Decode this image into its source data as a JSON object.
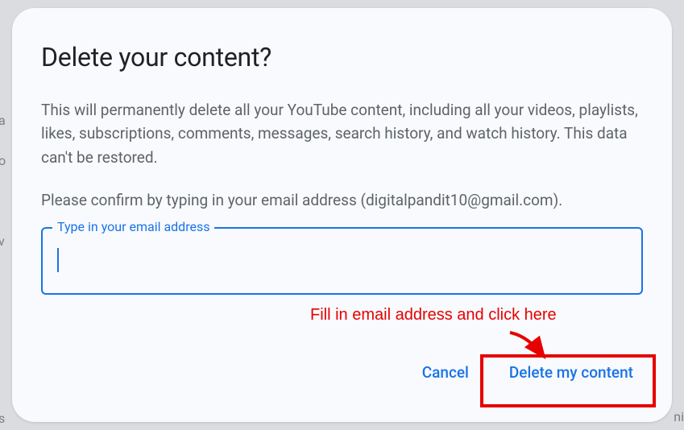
{
  "dialog": {
    "title": "Delete your content?",
    "body": "This will permanently delete all your YouTube content, including all your videos, playlists, likes, subscriptions, comments, messages, search history, and watch history. This data can't be restored.",
    "confirm_prompt": "Please confirm by typing in your email address (digitalpandit10@gmail.com).",
    "input_label": "Type in your email address",
    "input_value": "",
    "buttons": {
      "cancel": "Cancel",
      "delete": "Delete my content"
    }
  },
  "annotation": {
    "text": "Fill in email address and click here"
  },
  "colors": {
    "accent": "#1a73e8",
    "annotation": "#e60000",
    "text_primary": "#202124",
    "text_secondary": "#5f6368"
  }
}
